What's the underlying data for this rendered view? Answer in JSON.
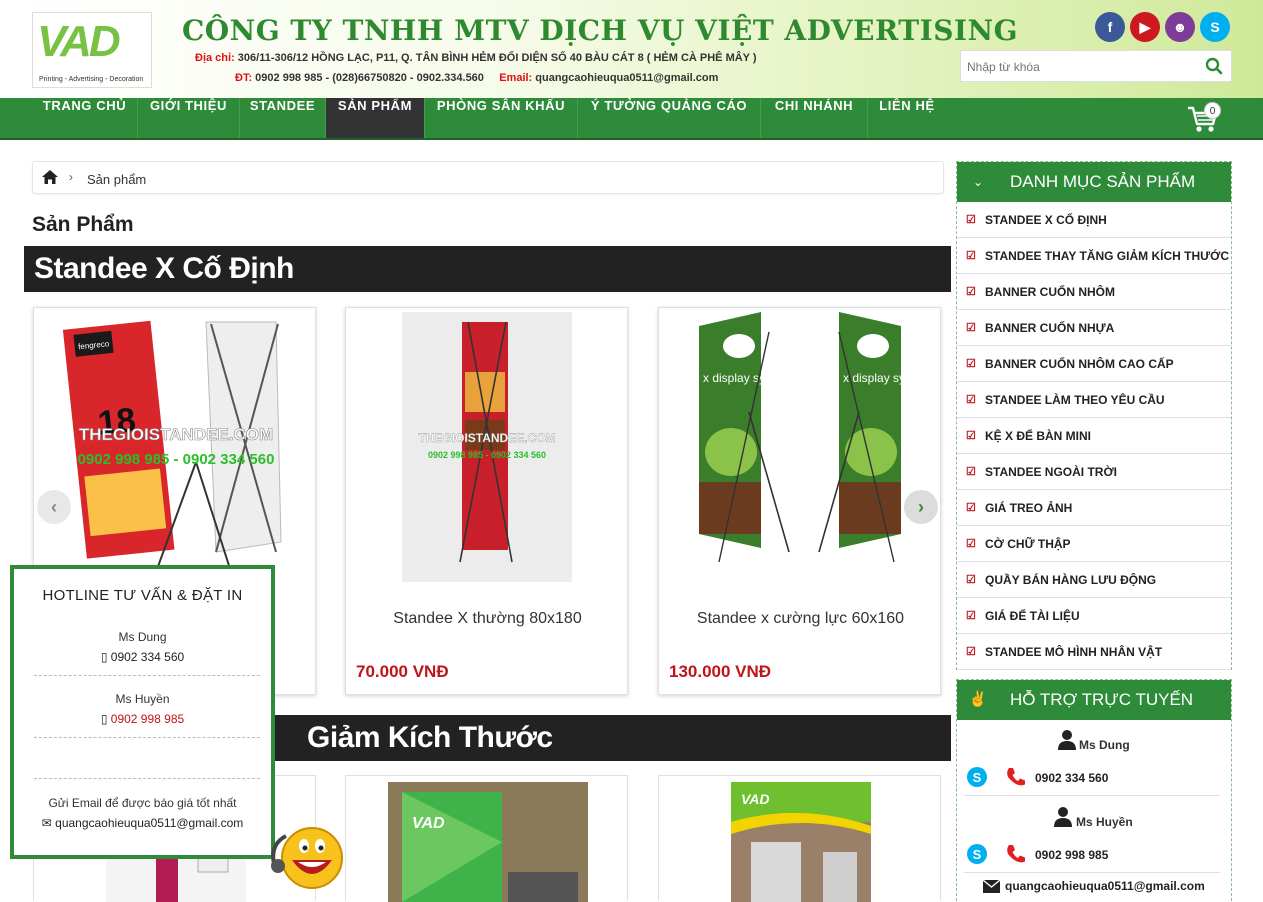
{
  "header": {
    "logo_mark": "VAD",
    "logo_tagline": "Printing - Advertising - Decoration",
    "company_name": "CÔNG TY TNHH MTV DỊCH VỤ VIỆT ADVERTISING",
    "address_label": "Địa chỉ:",
    "address_value": "306/11-306/12 HỒNG LẠC, P11, Q. TÂN BÌNH   HẺM ĐỐI DIỆN SỐ 40 BÀU CÁT 8 ( HẺM CÀ PHÊ MÂY )",
    "phone_label": "ĐT:",
    "phone_value": "0902 998 985 - (028)66750820 - 0902.334.560",
    "email_label": "Email:",
    "email_value": "quangcaohieuqua0511@gmail.com",
    "social": [
      {
        "name": "facebook-icon",
        "glyph": "f",
        "color": "#3b5998"
      },
      {
        "name": "youtube-icon",
        "glyph": "▶",
        "color": "#cc181e"
      },
      {
        "name": "smile-icon",
        "glyph": "☻",
        "color": "#7d3c98"
      },
      {
        "name": "skype-icon",
        "glyph": "S",
        "color": "#00aff0"
      }
    ],
    "search_placeholder": "Nhập từ khóa"
  },
  "nav": {
    "items": [
      "TRANG CHỦ",
      "GIỚI THIỆU",
      "STANDEE",
      "SẢN PHẨM",
      "PHÒNG SÂN KHẤU",
      "Ý TƯỞNG QUẢNG CÁO",
      "CHI NHÁNH",
      "LIÊN HỆ"
    ],
    "active": "SẢN PHẨM",
    "cart_count": "0"
  },
  "breadcrumb": {
    "current": "Sản phẩm"
  },
  "page_title": "Sản Phẩm",
  "sections": [
    {
      "title": "Standee X Cố Định"
    },
    {
      "title": "Giảm Kích Thước"
    }
  ],
  "products": [
    {
      "name": "Standee X thường 80x180",
      "price": "70.000 VNĐ"
    },
    {
      "name": "Standee x cường lực 60x160",
      "price": "130.000 VNĐ"
    }
  ],
  "product_image_text": {
    "watermark": "THEGIOISTANDEE.COM",
    "phones": "0902 998 985 - 0902 334 560",
    "display_brand": "x display systems"
  },
  "sidebar": {
    "categories_title": "DANH MỤC SẢN PHẨM",
    "categories": [
      "STANDEE X CỐ ĐỊNH",
      "STANDEE THAY TĂNG GIẢM KÍCH THƯỚC",
      "BANNER CUỐN NHÔM",
      "BANNER CUỐN NHỰA",
      "BANNER CUỐN NHÔM CAO CẤP",
      "STANDEE LÀM THEO YÊU CẦU",
      "KỆ X ĐỂ BÀN MINI",
      "STANDEE NGOÀI TRỜI",
      "GIÁ TREO ẢNH",
      "CỜ CHỮ THẬP",
      "QUẦY BÁN HÀNG LƯU ĐỘNG",
      "GIÁ ĐỂ TÀI LIỆU",
      "STANDEE MÔ HÌNH NHÂN VẬT"
    ],
    "support_title": "HỖ TRỢ TRỰC TUYẾN",
    "support": [
      {
        "name": "Ms Dung",
        "phone": "0902 334 560"
      },
      {
        "name": "Ms Huyền",
        "phone": "0902 998 985"
      }
    ],
    "support_email": "quangcaohieuqua0511@gmail.com"
  },
  "hotline": {
    "title": "HOTLINE TƯ VẤN & ĐẶT IN",
    "contacts": [
      {
        "name": "Ms Dung",
        "phone": "0902 334 560"
      },
      {
        "name": "Ms Huyền",
        "phone": "0902 998 985"
      }
    ],
    "email_note": "Gửi Email để được báo giá tốt nhất",
    "email": "quangcaohieuqua0511@gmail.com"
  }
}
